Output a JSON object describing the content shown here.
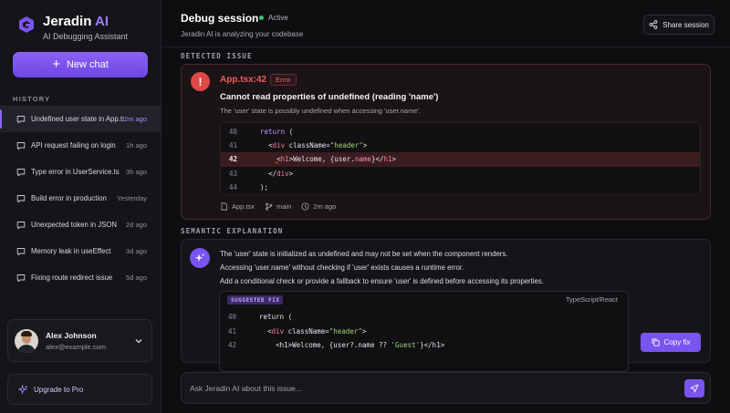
{
  "app": {
    "name": "Jeradin",
    "name_accent": "AI",
    "tagline": "AI Debugging Assistant",
    "accent_color": "#7a54ef",
    "logo_icon": "hexagon-logo-icon"
  },
  "sidebar": {
    "new_chat_label": "New chat",
    "history_label": "HISTORY",
    "history": [
      {
        "title": "Undefined user state in App.tsx",
        "time": "2m ago",
        "active": true
      },
      {
        "title": "API request failing on login",
        "time": "1h ago"
      },
      {
        "title": "Type error in UserService.ts",
        "time": "3h ago"
      },
      {
        "title": "Build error in production",
        "time": "Yesterday"
      },
      {
        "title": "Unexpected token in JSON",
        "time": "2d ago"
      },
      {
        "title": "Memory leak in useEffect",
        "time": "3d ago"
      },
      {
        "title": "Fixing route redirect issue",
        "time": "5d ago"
      }
    ],
    "user": {
      "name": "Alex Johnson",
      "email": "alex@example.com"
    },
    "upgrade_label": "Upgrade to Pro"
  },
  "header": {
    "title": "Debug session",
    "status": "Active",
    "subtitle": "Jeradin AI is analyzing your codebase",
    "share_label": "Share session"
  },
  "issue": {
    "section_label": "DETECTED ISSUE",
    "file_ref": "App.tsx:42",
    "badge": "Error",
    "title": "Cannot read properties of undefined (reading 'name')",
    "description": "The 'user' state is possibly undefined when accessing 'user.name'.",
    "code": [
      {
        "ln": "40",
        "indent": "  ",
        "parts": [
          [
            "kw",
            "return"
          ],
          [
            "",
            " ("
          ]
        ]
      },
      {
        "ln": "41",
        "indent": "    ",
        "parts": [
          [
            "",
            "<"
          ],
          [
            "tag",
            "div"
          ],
          [
            "",
            " className="
          ],
          [
            "str",
            "\"header\""
          ],
          [
            "",
            ">"
          ]
        ]
      },
      {
        "ln": "42",
        "indent": "      ",
        "highlight": true,
        "parts": [
          [
            "",
            "<"
          ],
          [
            "tag",
            "h1"
          ],
          [
            "",
            ">Welcome, {user."
          ],
          [
            "var",
            "name"
          ],
          [
            "",
            "}</"
          ],
          [
            "tag",
            "h1"
          ],
          [
            "",
            ">"
          ]
        ]
      },
      {
        "ln": "43",
        "indent": "    ",
        "parts": [
          [
            "",
            "</"
          ],
          [
            "tag",
            "div"
          ],
          [
            "",
            ">"
          ]
        ]
      },
      {
        "ln": "44",
        "indent": "  ",
        "parts": [
          [
            "",
            ");"
          ]
        ]
      }
    ],
    "meta": {
      "file": "App.tsx",
      "branch": "main",
      "time": "2m ago"
    }
  },
  "explanation": {
    "section_label": "SEMANTIC EXPLANATION",
    "paragraphs": [
      "The 'user' state is initialized as undefined and may not be set when the component renders.",
      "Accessing 'user.name' without checking if 'user' exists causes a runtime error.",
      "Add a conditional check or provide a fallback to ensure 'user' is defined before accessing its properties."
    ],
    "fix": {
      "badge": "SUGGESTED FIX",
      "language": "TypeScript/React",
      "code": [
        {
          "ln": "40",
          "indent": "  ",
          "parts": [
            [
              "",
              "return ("
            ]
          ]
        },
        {
          "ln": "41",
          "indent": "    ",
          "parts": [
            [
              "",
              "<"
            ],
            [
              "tag",
              "div"
            ],
            [
              "",
              " className="
            ],
            [
              "str",
              "\"header\""
            ],
            [
              "",
              ">"
            ]
          ]
        },
        {
          "ln": "42",
          "indent": "      ",
          "parts": [
            [
              "",
              "<h1>Welcome, {user?.name ?? "
            ],
            [
              "str",
              "'Guest'"
            ],
            [
              "",
              "}</h1>"
            ]
          ]
        }
      ],
      "copy_label": "Copy fix"
    }
  },
  "composer": {
    "placeholder": "Ask Jeradin AI about this issue...",
    "send_icon": "send-icon"
  }
}
